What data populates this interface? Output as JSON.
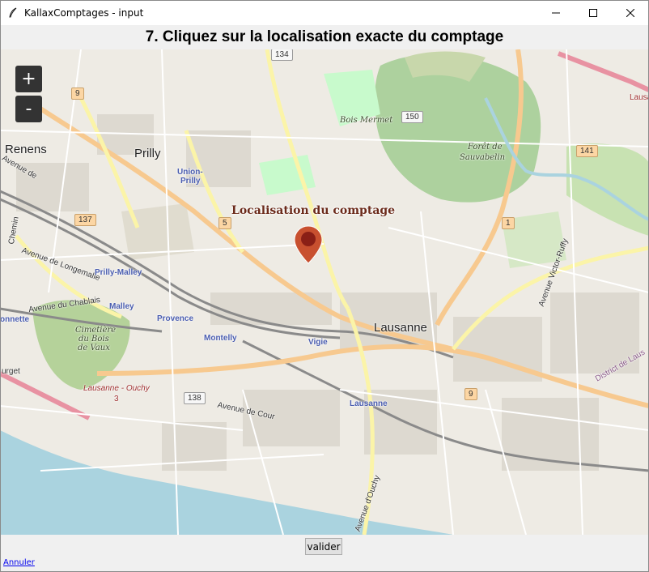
{
  "window": {
    "title": "KallaxComptages - input",
    "app_icon": "feather-icon",
    "controls": [
      "minimize-icon",
      "maximize-icon",
      "close-icon"
    ]
  },
  "heading": "7. Cliquez sur la localisation exacte du comptage",
  "map": {
    "zoom_in_label": "+",
    "zoom_out_label": "-",
    "marker_label": "Localisation du comptage",
    "marker_color": "#c8502f",
    "places": {
      "renens": "Renens",
      "prilly": "Prilly",
      "lausanne": "Lausanne",
      "bois_mermet": "Bois Mermet",
      "foret_1": "Forêt de",
      "foret_2": "Sauvabelin",
      "cimetiere_1": "Cimetière",
      "cimetiere_2": "du Bois",
      "cimetiere_3": "de Vaux",
      "ouchy": "Lausanne - Ouchy",
      "ouchy_num": "3",
      "ave_longemalle": "Avenue de Longemalle",
      "ave_chablais": "Avenue du Chablais",
      "ave_cour": "Avenue de Cour",
      "ave_ouchy": "Avenue d'Ouchy",
      "ave_ruffy": "Avenue Victor-Ruffy",
      "ave_partial": "Avenue de",
      "chemin_partial": "Chemin",
      "district": "District de Laus",
      "lausa_edge": "Lausa",
      "onnette": "onnette",
      "urget": "urget"
    },
    "stations": {
      "union_prilly_1": "Union-",
      "union_prilly_2": "Prilly",
      "prilly_malley": "Prilly-Malley",
      "malley": "Malley",
      "provence": "Provence",
      "montelly": "Montelly",
      "vigie": "Vigie",
      "lausanne": "Lausanne"
    },
    "routes": {
      "r134": "134",
      "r9a": "9",
      "r150": "150",
      "r141": "141",
      "r137": "137",
      "r5": "5",
      "r1": "1",
      "r138": "138",
      "r9b": "9"
    }
  },
  "bottom": {
    "valider_label": "valider",
    "annuler_label": "Annuler"
  }
}
